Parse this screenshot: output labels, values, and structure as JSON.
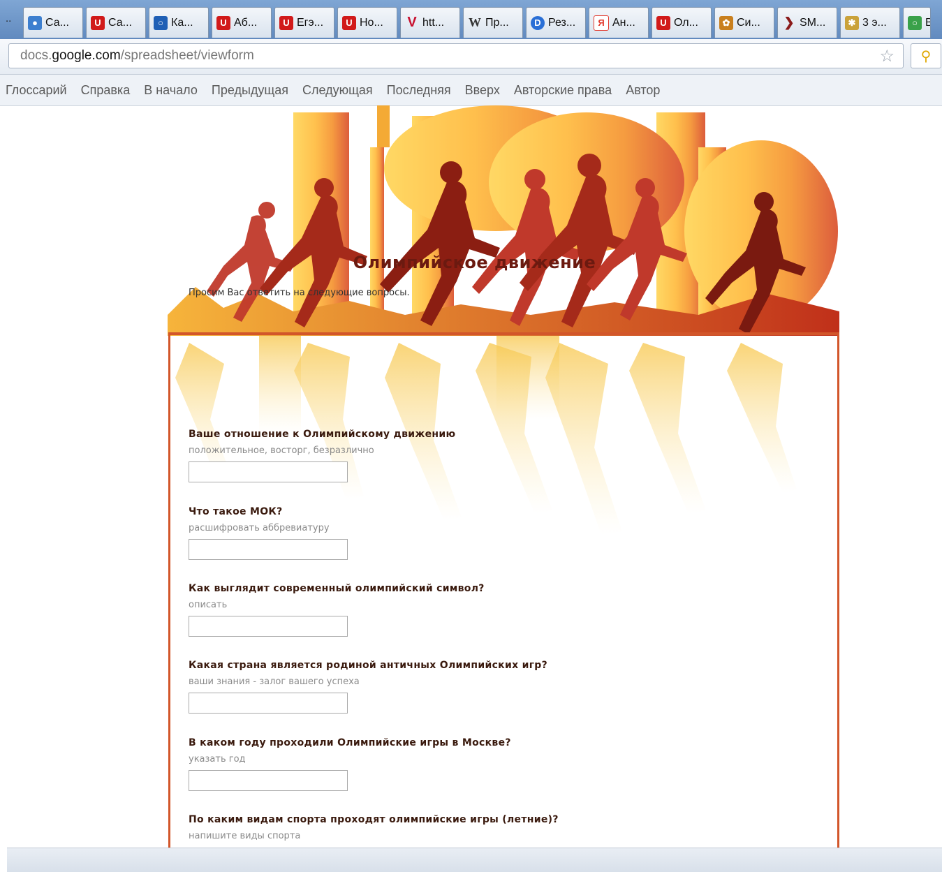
{
  "browser": {
    "tab_lead": "..",
    "tabs": [
      {
        "label": "Са...",
        "icon": "globe-icon",
        "color": "#3d7fcf"
      },
      {
        "label": "Са...",
        "icon": "red-u-icon",
        "color": "#d11a1a"
      },
      {
        "label": "Ка...",
        "icon": "blue-square-icon",
        "color": "#1f5fb5"
      },
      {
        "label": "Аб...",
        "icon": "red-u-icon",
        "color": "#d11a1a"
      },
      {
        "label": "Егэ...",
        "icon": "red-u-icon",
        "color": "#d11a1a"
      },
      {
        "label": "Но...",
        "icon": "red-u-icon",
        "color": "#d11a1a"
      },
      {
        "label": "htt...",
        "icon": "red-v-icon",
        "color": "#c8102e"
      },
      {
        "label": "Пр...",
        "icon": "wikipedia-icon",
        "color": "#555555"
      },
      {
        "label": "Рез...",
        "icon": "blue-d-icon",
        "color": "#2a6fd6"
      },
      {
        "label": "Ан...",
        "icon": "yandex-icon",
        "color": "#e23a2e"
      },
      {
        "label": "Ол...",
        "icon": "red-u-icon",
        "color": "#d11a1a"
      },
      {
        "label": "Си...",
        "icon": "emblem-icon",
        "color": "#c9801f"
      },
      {
        "label": "SM...",
        "icon": "arrow-icon",
        "color": "#8a1a1a"
      },
      {
        "label": "3 э...",
        "icon": "wheat-icon",
        "color": "#caa23a"
      },
      {
        "label": "В",
        "icon": "green-icon",
        "color": "#3aa14a"
      }
    ],
    "url_host": "docs.google.com",
    "url_path": "/spreadsheet/viewform",
    "url_prefix": "docs.",
    "url_host_bold": "google.com"
  },
  "bookmarks": [
    "Глоссарий",
    "Справка",
    "В начало",
    "Предыдущая",
    "Следующая",
    "Последняя",
    "Вверх",
    "Авторские права",
    "Автор"
  ],
  "form": {
    "title": "Олимпийское движение",
    "description": "Просим Вас ответить на следующие вопросы.",
    "questions": [
      {
        "title": "Ваше отношение к Олимпийскому движению",
        "help": "положительное, восторг, безразлично",
        "value": ""
      },
      {
        "title": "Что такое МОК?",
        "help": "расшифровать аббревиатуру",
        "value": ""
      },
      {
        "title": "Как выглядит современный олимпийский символ?",
        "help": "описать",
        "value": ""
      },
      {
        "title": "Какая страна является родиной античных Олимпийских игр?",
        "help": "ваши знания - залог вашего успеха",
        "value": ""
      },
      {
        "title": "В каком году проходили Олимпийские игры в Москве?",
        "help": "указать год",
        "value": ""
      },
      {
        "title": "По каким видам спорта проходят олимпийские игры (летние)?",
        "help": "напишите виды спорта",
        "value": ""
      }
    ]
  },
  "colors": {
    "accent": "#d2562a",
    "title": "#6b1a10"
  }
}
